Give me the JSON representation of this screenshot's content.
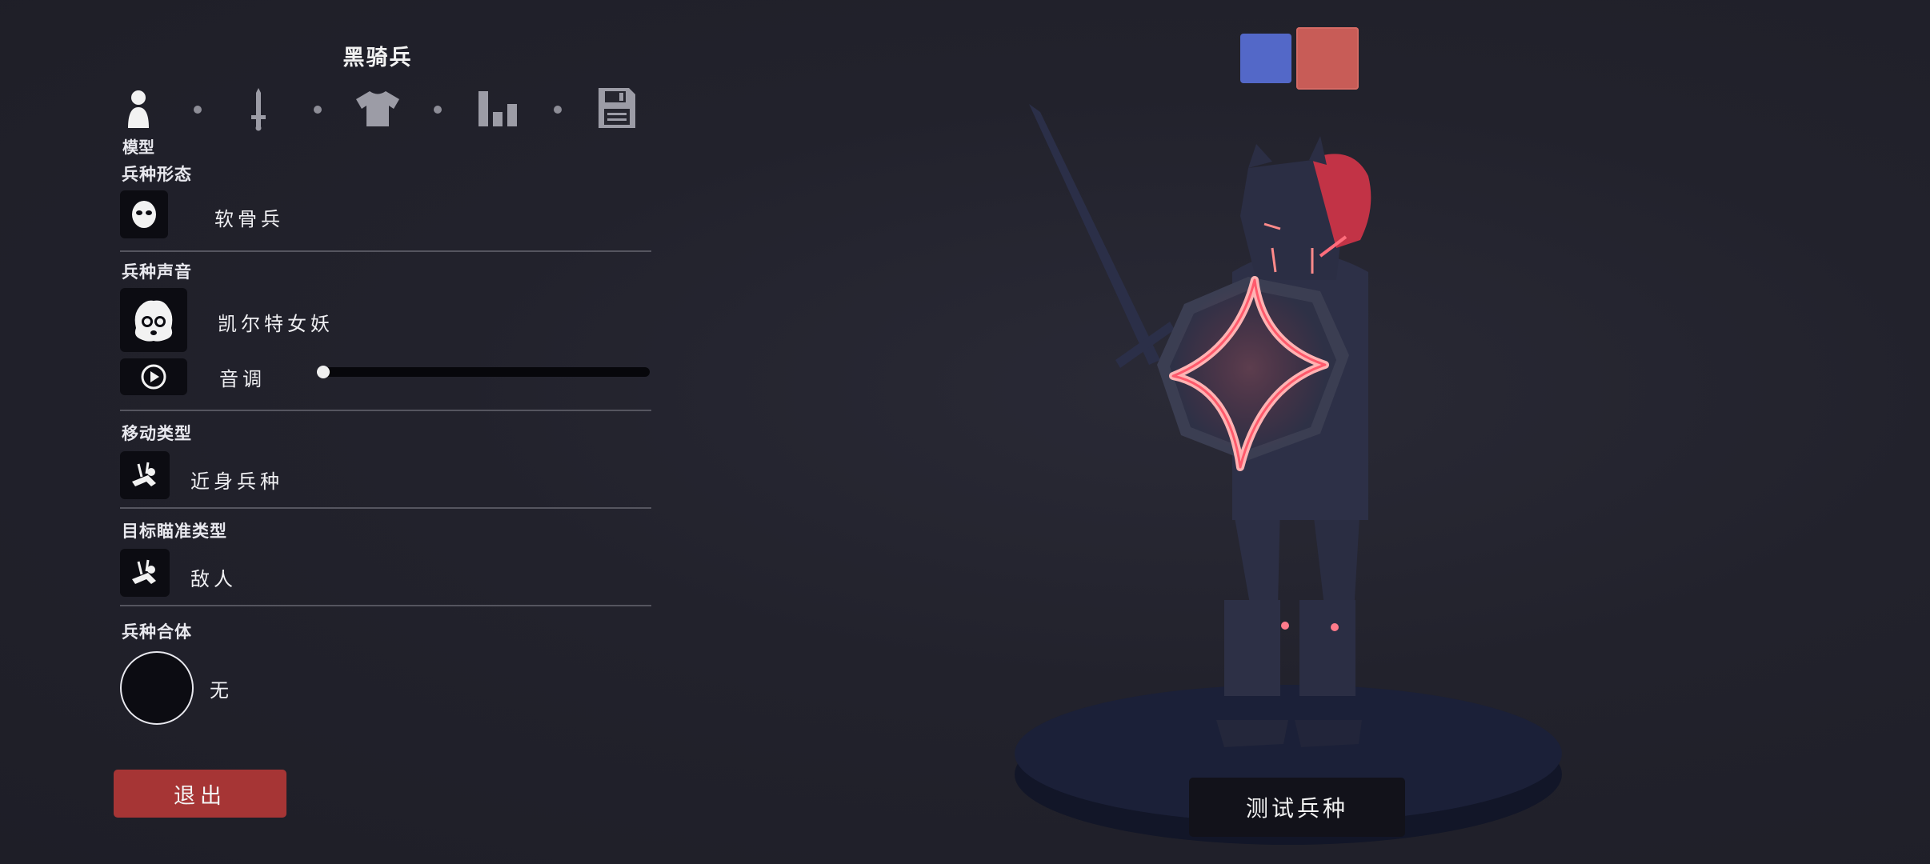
{
  "header": {
    "unit_name": "黑骑兵"
  },
  "steps": [
    {
      "icon": "person-icon",
      "label": "模型"
    },
    {
      "icon": "sword-icon"
    },
    {
      "icon": "shirt-icon"
    },
    {
      "icon": "stats-bars-icon"
    },
    {
      "icon": "save-disk-icon"
    }
  ],
  "sections": {
    "form": {
      "label": "兵种形态",
      "value": "软骨兵",
      "icon": "mask-face-icon"
    },
    "voice": {
      "label": "兵种声音",
      "value": "凯尔特女妖",
      "icon": "banshee-face-icon",
      "play_icon": "play-icon",
      "pitch_label": "音调",
      "pitch_value": 0.0
    },
    "movement": {
      "label": "移动类型",
      "value": "近身兵种",
      "icon": "melee-unit-icon"
    },
    "targeting": {
      "label": "目标瞄准类型",
      "value": "敌人",
      "icon": "target-enemy-icon"
    },
    "combine": {
      "label": "兵种合体",
      "value": "无"
    }
  },
  "buttons": {
    "exit": "退出",
    "test": "测试兵种"
  },
  "team_colors": {
    "blue": "#5368c8",
    "red": "#c85c57"
  }
}
